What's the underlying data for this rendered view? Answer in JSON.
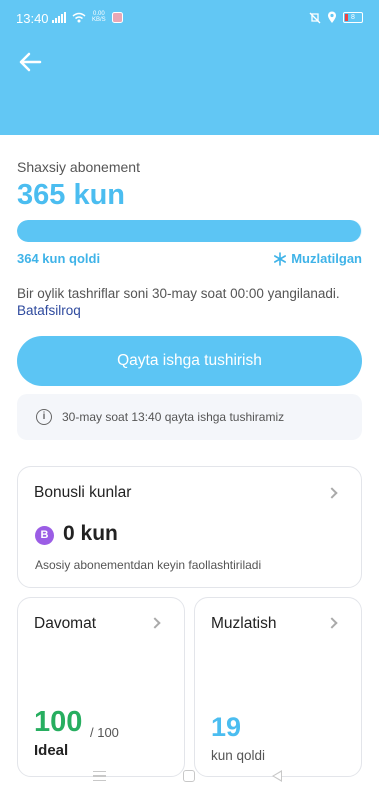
{
  "status_bar": {
    "time": "13:40",
    "net_speed_value": "0.00",
    "net_speed_unit": "KB/S",
    "battery": "8"
  },
  "subscription": {
    "label": "Shaxsiy abonement",
    "total_days": "365 kun",
    "progress_fraction": 0.997,
    "days_left": "364 kun qoldi",
    "frozen_status": "Muzlatilgan",
    "info_text": "Bir oylik tashriflar soni 30-may soat 00:00 yangilanadi.",
    "info_link": "Batafsilroq"
  },
  "restart_button": "Qayta ishga tushirish",
  "notice": {
    "icon": "info-icon",
    "text": "30-may soat 13:40 qayta ishga tushiramiz"
  },
  "bonus_card": {
    "title": "Bonusli kunlar",
    "badge": "B",
    "value": "0 kun",
    "note": "Asosiy abonementdan keyin faollashtiriladi"
  },
  "attendance_card": {
    "title": "Davomat",
    "value": "100",
    "max": "/ 100",
    "label": "Ideal"
  },
  "freeze_card": {
    "title": "Muzlatish",
    "value": "19",
    "label": "kun qoldi"
  },
  "colors": {
    "accent": "#5cc5f4",
    "header": "#62c7f4",
    "attendance": "#27ae60",
    "bonus_badge": "#9b5de5",
    "link": "#2e4a9e"
  }
}
